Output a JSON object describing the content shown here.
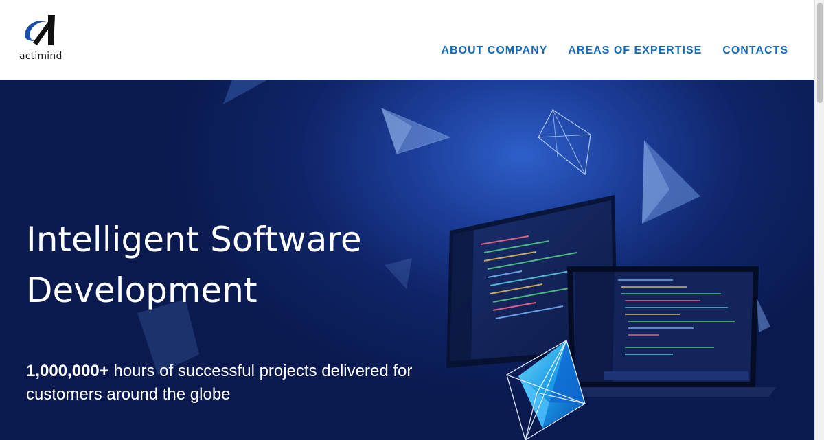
{
  "brand": {
    "name": "actimind"
  },
  "nav": {
    "items": [
      {
        "label": "ABOUT COMPANY"
      },
      {
        "label": "AREAS OF EXPERTISE"
      },
      {
        "label": "CONTACTS"
      }
    ]
  },
  "hero": {
    "title": "Intelligent Software Development",
    "subtitle_bold": "1,000,000+",
    "subtitle_rest": " hours of successful projects delivered for customers around the globe"
  },
  "colors": {
    "nav_link": "#1769b8",
    "hero_bg": "#0f2468",
    "logo_blue": "#1a4fa8"
  }
}
